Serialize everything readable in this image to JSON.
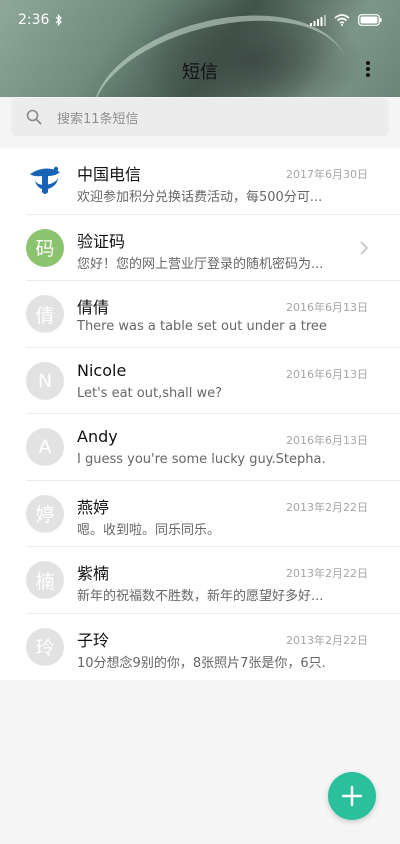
{
  "status": {
    "time": "2:36",
    "bluetooth_icon": "bluetooth-icon",
    "signal_icon": "signal-icon",
    "wifi_icon": "wifi-icon",
    "battery_icon": "battery-icon"
  },
  "header": {
    "title": "短信",
    "more_icon": "more-vertical-icon"
  },
  "search": {
    "placeholder": "搜索11条短信",
    "icon": "search-icon"
  },
  "conversations": [
    {
      "name": "中国电信",
      "preview": "欢迎参加积分兑换话费活动，每500分可...",
      "date": "2017年6月30日",
      "avatar": "logo",
      "avatar_icon": "china-telecom-logo"
    },
    {
      "name": "验证码",
      "preview": "您好！您的网上营业厅登录的随机密码为...",
      "date": "",
      "avatar": "码",
      "avatar_color": "#8cc36f",
      "trailing_icon": "chevron-right-icon"
    },
    {
      "name": "倩倩",
      "preview": "There was a table set out under a tree i...",
      "date": "2016年6月13日",
      "avatar": "倩"
    },
    {
      "name": "Nicole",
      "preview": "Let's eat out,shall we?",
      "date": "2016年6月13日",
      "avatar": "N"
    },
    {
      "name": "Andy",
      "preview": "I guess you're some lucky guy.Stepha...",
      "date": "2016年6月13日",
      "avatar": "A"
    },
    {
      "name": "燕婷",
      "preview": "嗯。收到啦。同乐同乐。",
      "date": "2013年2月22日",
      "avatar": "婷"
    },
    {
      "name": "紫楠",
      "preview": "新年的祝福数不胜数，新年的愿望好多好...",
      "date": "2013年2月22日",
      "avatar": "楠"
    },
    {
      "name": "子玲",
      "preview": "10分想念9别的你，8张照片7张是你，6只...",
      "date": "2013年2月22日",
      "avatar": "玲"
    }
  ],
  "fab": {
    "icon": "plus-icon"
  },
  "colors": {
    "accent": "#2bbf9c",
    "verify_avatar": "#8cc36f"
  }
}
